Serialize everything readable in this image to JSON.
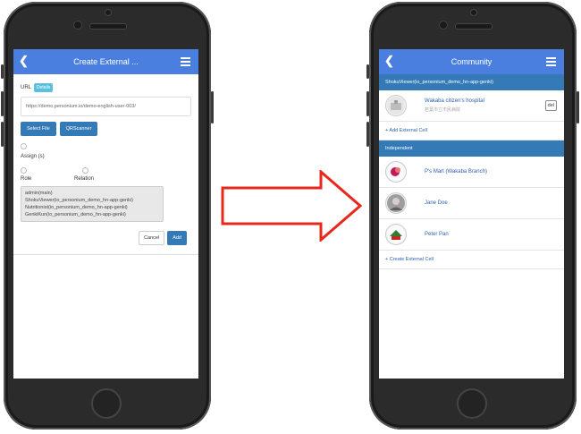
{
  "left_screen": {
    "header": {
      "title": "Create External ...",
      "back_icon": "chevron-left-icon",
      "menu_icon": "hamburger-menu-icon"
    },
    "url_label": "URL",
    "details_label": "Details",
    "url_value": "https://demo.personium.io/demo-english-user-003/",
    "select_file_label": "Select File",
    "qr_scanner_label": "QRScanner",
    "assign_label": "Assign (s)",
    "role_label": "Role",
    "relation_label": "Relation",
    "roles": [
      "admin(main)",
      "ShokuViewer(io_personium_demo_hn-app-genki)",
      "Nutritionist(io_personium_demo_hn-app-genki)",
      "GenkiKun(io_personium_demo_hn-app-genki)"
    ],
    "cancel_label": "Cancel",
    "add_label": "Add"
  },
  "right_screen": {
    "header": {
      "title": "Community",
      "back_icon": "chevron-left-icon",
      "menu_icon": "hamburger-menu-icon"
    },
    "section1_title": "ShokuViewer(io_personium_demo_hn-app-genki)",
    "hospital_name": "Wakaba citizen's hospital",
    "hospital_sub": "若葉市立市民病院",
    "del_label": "del",
    "add_external_cell_label": "+ Add External Cell",
    "section2_title": "Independent",
    "cells": [
      {
        "name": "P's Mart (Wakaba Branch)"
      },
      {
        "name": "Jane Doe"
      },
      {
        "name": "Peter Pan"
      }
    ],
    "create_external_cell_label": "+ Create External Cell"
  },
  "colors": {
    "header": "#4a7fe0",
    "section_bar": "#337ab7",
    "arrow": "#e8281c"
  }
}
